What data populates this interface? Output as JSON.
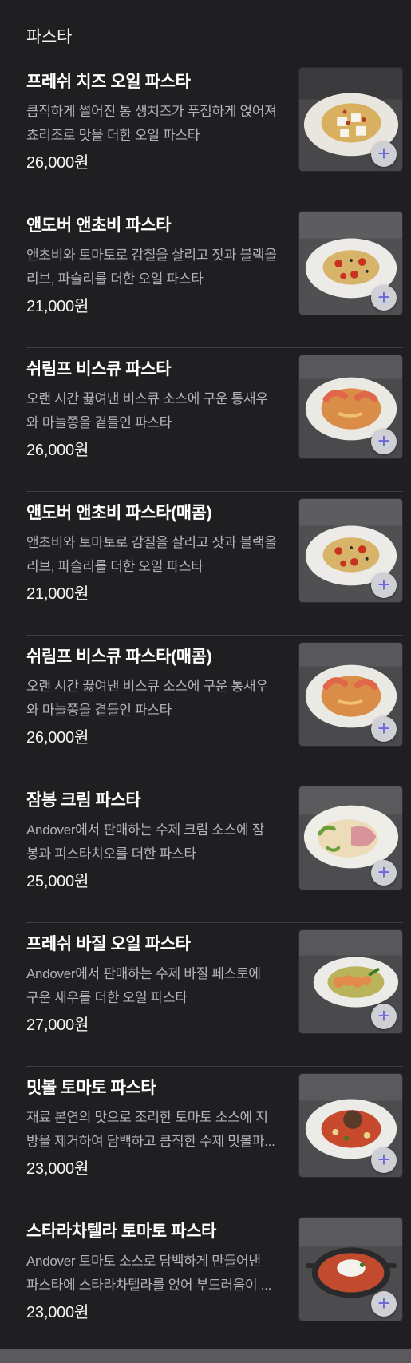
{
  "section": {
    "title": "파스타"
  },
  "items": [
    {
      "name": "프레쉬 치즈 오일 파스타",
      "desc_line1": "큼직하게 썰어진 통 생치즈가 푸짐하게 얹어져",
      "desc_line2": "쵸리조로 맛을 더한 오일 파스타",
      "price": "26,000원",
      "image_icon": "pasta-cheese-icon",
      "add_label": "+"
    },
    {
      "name": "앤도버 앤초비 파스타",
      "desc_line1": "앤초비와 토마토로 감칠을 살리고 잣과 블랙올",
      "desc_line2": "리브, 파슬리를 더한 오일 파스타",
      "price": "21,000원",
      "image_icon": "pasta-anchovy-icon",
      "add_label": "+"
    },
    {
      "name": "쉬림프 비스큐 파스타",
      "desc_line1": "오랜 시간 끓여낸 비스큐 소스에 구운 통새우",
      "desc_line2": "와 마늘쫑을 곁들인 파스타",
      "price": "26,000원",
      "image_icon": "pasta-shrimp-icon",
      "add_label": "+"
    },
    {
      "name": "앤도버 앤초비 파스타(매콤)",
      "desc_line1": "앤초비와 토마토로 감칠을 살리고 잣과 블랙올",
      "desc_line2": "리브, 파슬리를 더한 오일 파스타",
      "price": "21,000원",
      "image_icon": "pasta-anchovy-icon",
      "add_label": "+"
    },
    {
      "name": "쉬림프 비스큐 파스타(매콤)",
      "desc_line1": "오랜 시간 끓여낸 비스큐 소스에 구운 통새우",
      "desc_line2": "와 마늘쫑을 곁들인 파스타",
      "price": "26,000원",
      "image_icon": "pasta-shrimp-icon",
      "add_label": "+"
    },
    {
      "name": "잠봉 크림 파스타",
      "desc_line1": "Andover에서 판매하는 수제 크림 소스에 잠",
      "desc_line2": "봉과 피스타치오를 더한 파스타",
      "price": "25,000원",
      "image_icon": "pasta-jambon-icon",
      "add_label": "+"
    },
    {
      "name": "프레쉬 바질 오일 파스타",
      "desc_line1": "Andover에서 판매하는 수제 바질 페스토에",
      "desc_line2": "구운 새우를 더한 오일 파스타",
      "price": "27,000원",
      "image_icon": "pasta-basil-icon",
      "add_label": "+"
    },
    {
      "name": "밋볼 토마토 파스타",
      "desc_line1": "재료 본연의 맛으로 조리한 토마토 소스에 지",
      "desc_line2": "방을 제거하여 담백하고 큼직한 수제 밋볼파...",
      "price": "23,000원",
      "image_icon": "pasta-meatball-icon",
      "add_label": "+"
    },
    {
      "name": "스타라차텔라 토마토 파스타",
      "desc_line1": "Andover 토마토 소스로 담백하게 만들어낸",
      "desc_line2": "파스타에 스타라차텔라를 얹어 부드러움이 ...",
      "price": "23,000원",
      "image_icon": "pasta-stracciatella-icon",
      "add_label": "+"
    }
  ],
  "colors": {
    "background": "#1f1f21",
    "divider": "#3f3f42",
    "desc_text": "#b4b4b8",
    "add_button_bg": "#cfcfd6",
    "add_button_plus": "#6b67d8"
  }
}
